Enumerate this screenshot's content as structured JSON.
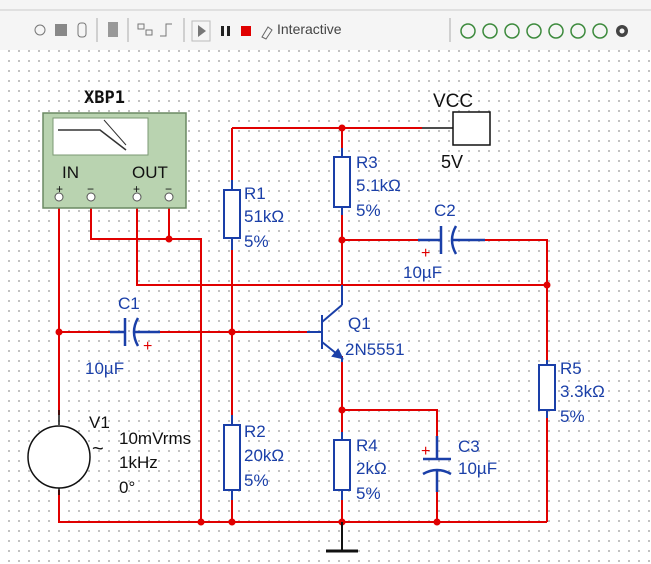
{
  "toolbar": {
    "mode_label": "Interactive"
  },
  "instrument": {
    "name": "XBP1",
    "in_label": "IN",
    "out_label": "OUT",
    "plus": "+",
    "minus": "−"
  },
  "vcc": {
    "label": "VCC",
    "value": "5V"
  },
  "components": {
    "r1": {
      "ref": "R1",
      "value": "51kΩ",
      "tol": "5%"
    },
    "r2": {
      "ref": "R2",
      "value": "20kΩ",
      "tol": "5%"
    },
    "r3": {
      "ref": "R3",
      "value": "5.1kΩ",
      "tol": "5%"
    },
    "r4": {
      "ref": "R4",
      "value": "2kΩ",
      "tol": "5%"
    },
    "r5": {
      "ref": "R5",
      "value": "3.3kΩ",
      "tol": "5%"
    },
    "c1": {
      "ref": "C1",
      "value": "10µF",
      "plus": "+"
    },
    "c2": {
      "ref": "C2",
      "value": "10µF",
      "plus": "+"
    },
    "c3": {
      "ref": "C3",
      "value": "10µF",
      "plus": "+"
    },
    "q1": {
      "ref": "Q1",
      "part": "2N5551"
    },
    "v1": {
      "ref": "V1",
      "amplitude": "10mVrms",
      "freq": "1kHz",
      "phase": "0°",
      "symbol": "~"
    }
  },
  "colors": {
    "wire": "#e00000",
    "component": "#1a3fa8",
    "accent": "#e00000",
    "instrument": "#b9d3b0"
  }
}
